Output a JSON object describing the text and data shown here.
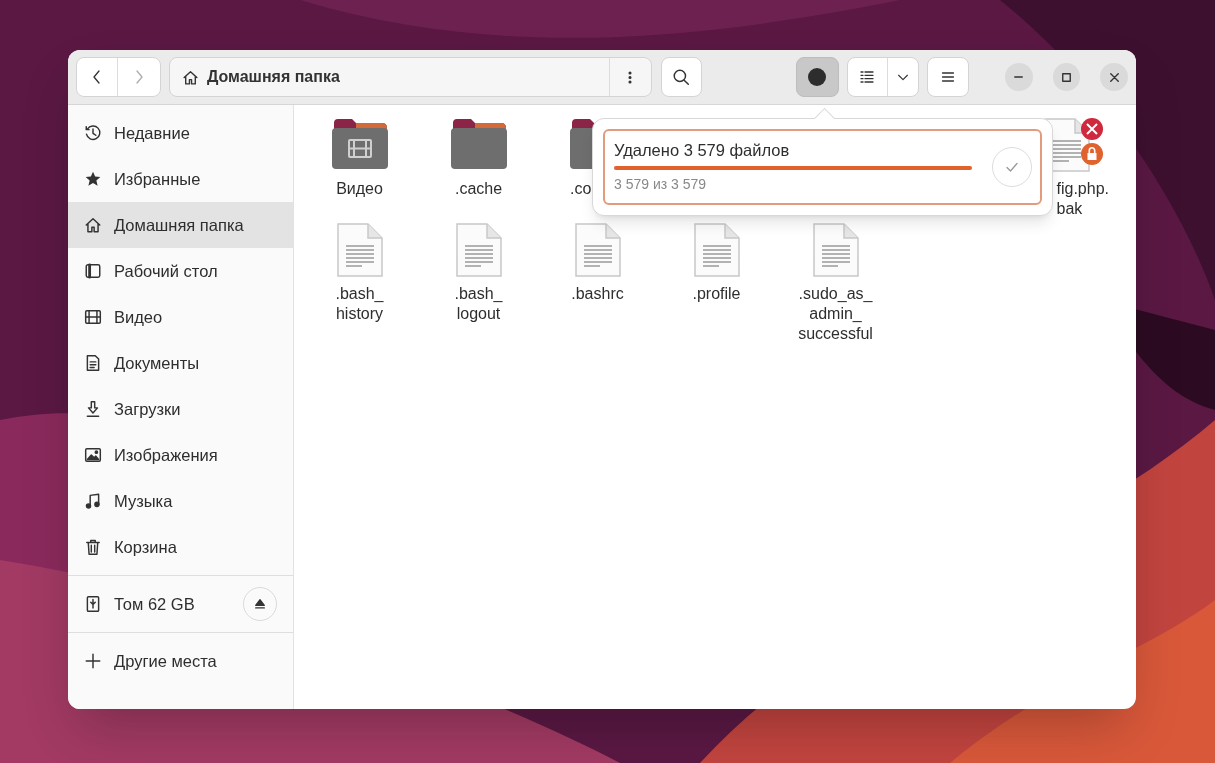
{
  "header": {
    "back_button": {
      "disabled": false
    },
    "forward_button": {
      "disabled": true
    },
    "location": "Домашняя папка",
    "operations_button": {
      "pressed": true
    }
  },
  "sidebar": {
    "items": [
      {
        "kind": "place",
        "label": "Недавние",
        "selected": false
      },
      {
        "kind": "place",
        "label": "Избранные",
        "selected": false
      },
      {
        "kind": "place",
        "label": "Домашняя папка",
        "selected": true
      },
      {
        "kind": "place",
        "label": "Рабочий стол",
        "selected": false
      },
      {
        "kind": "place",
        "label": "Видео",
        "selected": false
      },
      {
        "kind": "place",
        "label": "Документы",
        "selected": false
      },
      {
        "kind": "place",
        "label": "Загрузки",
        "selected": false
      },
      {
        "kind": "place",
        "label": "Изображения",
        "selected": false
      },
      {
        "kind": "place",
        "label": "Музыка",
        "selected": false
      },
      {
        "kind": "place",
        "label": "Корзина",
        "selected": false
      },
      {
        "kind": "device",
        "label": "Том 62 GB",
        "selected": false
      },
      {
        "kind": "action",
        "label": "Другие места",
        "selected": false
      }
    ]
  },
  "files": [
    {
      "kind": "video-folder",
      "label": "Видео"
    },
    {
      "kind": "folder",
      "label": ".cache"
    },
    {
      "kind": "folder",
      "label": ".co"
    },
    {
      "kind": "locked-file",
      "label": "fig.php.bak"
    },
    {
      "kind": "file",
      "label": ".bash_history"
    },
    {
      "kind": "file",
      "label": ".bash_logout"
    },
    {
      "kind": "file",
      "label": ".bashrc"
    },
    {
      "kind": "file",
      "label": ".profile"
    },
    {
      "kind": "file",
      "label": ".sudo_as_admin_successful"
    }
  ],
  "operations_popover": {
    "title": "Удалено 3 579 файлов",
    "level": 1,
    "subtitle": "3 579 из 3 579"
  }
}
